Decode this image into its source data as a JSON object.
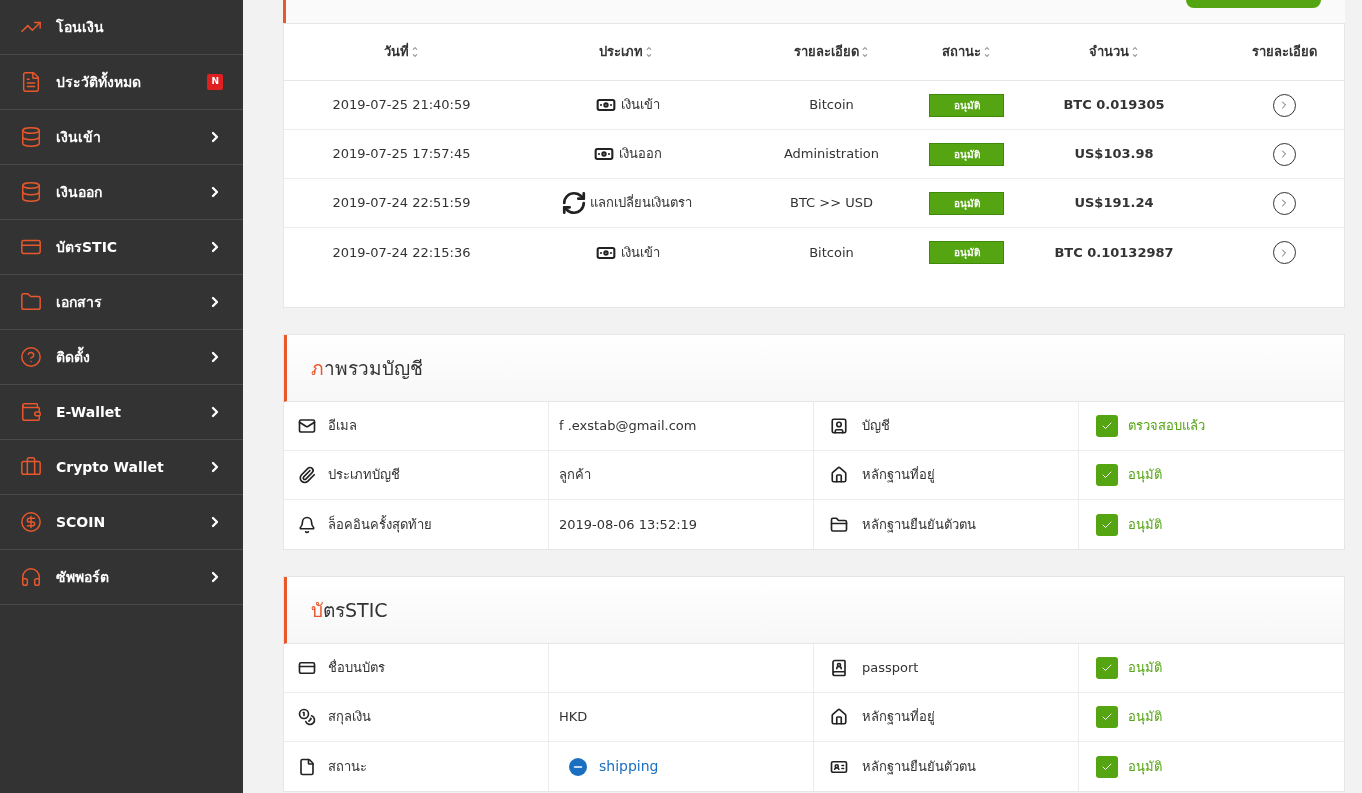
{
  "sidebar": {
    "items": [
      {
        "label": "โอนเงิน",
        "expandable": false
      },
      {
        "label": "ประวัติทั้งหมด",
        "badge": "N",
        "expandable": false
      },
      {
        "label": "เงินเข้า",
        "expandable": true
      },
      {
        "label": "เงินออก",
        "expandable": true
      },
      {
        "label": "บัตรSTIC",
        "expandable": true
      },
      {
        "label": "เอกสาร",
        "expandable": true
      },
      {
        "label": "ติดตั้ง",
        "expandable": true
      },
      {
        "label": "E-Wallet",
        "expandable": true
      },
      {
        "label": "Crypto Wallet",
        "expandable": true
      },
      {
        "label": "SCOIN",
        "expandable": true
      },
      {
        "label": "ซัพพอร์ต",
        "expandable": true
      }
    ]
  },
  "history_table": {
    "columns": [
      {
        "label": "วันที่",
        "sortable": true
      },
      {
        "label": "ประเภท",
        "sortable": true
      },
      {
        "label": "รายละเอียด",
        "sortable": true
      },
      {
        "label": "สถานะ",
        "sortable": true
      },
      {
        "label": "จำนวน",
        "sortable": true
      },
      {
        "label": "รายละเอียด",
        "sortable": false
      }
    ],
    "rows": [
      {
        "date": "2019-07-25 21:40:59",
        "type": {
          "kind": "deposit",
          "label": "เงินเข้า"
        },
        "detail": "Bitcoin",
        "status": "อนุมัติ",
        "amount": "BTC 0.019305"
      },
      {
        "date": "2019-07-25 17:57:45",
        "type": {
          "kind": "withdraw",
          "label": "เงินออก"
        },
        "detail": "Administration",
        "status": "อนุมัติ",
        "amount": "US$103.98"
      },
      {
        "date": "2019-07-24 22:51:59",
        "type": {
          "kind": "exchange",
          "label": "แลกเปลี่ยนเงินตรา"
        },
        "detail": "BTC >> USD",
        "status": "อนุมัติ",
        "amount": "US$191.24"
      },
      {
        "date": "2019-07-24 22:15:36",
        "type": {
          "kind": "deposit",
          "label": "เงินเข้า"
        },
        "detail": "Bitcoin",
        "status": "อนุมัติ",
        "amount": "BTC 0.10132987"
      }
    ]
  },
  "sections": [
    {
      "title_accent": "ภ",
      "title_rest": "าพรวมบัญชี",
      "rows": [
        {
          "label": "อีเมล",
          "value": "f .exstab@gmail.com",
          "doc": "บัญชี",
          "doc_status": "ตรวจสอบแล้ว",
          "verified": true
        },
        {
          "label": "ประเภทบัญชี",
          "value": "ลูกค้า",
          "doc": "หลักฐานที่อยู่",
          "doc_status": "อนุมัติ",
          "verified": true
        },
        {
          "label": "ล็อคอินครั้งสุดท้าย",
          "value": "2019-08-06 13:52:19",
          "doc": "หลักฐานยืนยันตัวตน",
          "doc_status": "อนุมัติ",
          "verified": true
        }
      ]
    },
    {
      "title_accent": "บั",
      "title_rest": "ตรSTIC",
      "rows": [
        {
          "label": "ชื่อบนบัตร",
          "doc": "passport",
          "doc_status": "อนุมัติ",
          "verified": true
        },
        {
          "label": "สกุลเงิน",
          "value": "HKD",
          "doc": "หลักฐานที่อยู่",
          "doc_status": "อนุมัติ",
          "verified": true
        },
        {
          "label": "สถานะ",
          "shipping_status": "shipping",
          "doc": "หลักฐานยืนยันตัวตน",
          "doc_status": "อนุมัติ",
          "verified": true
        }
      ]
    }
  ]
}
